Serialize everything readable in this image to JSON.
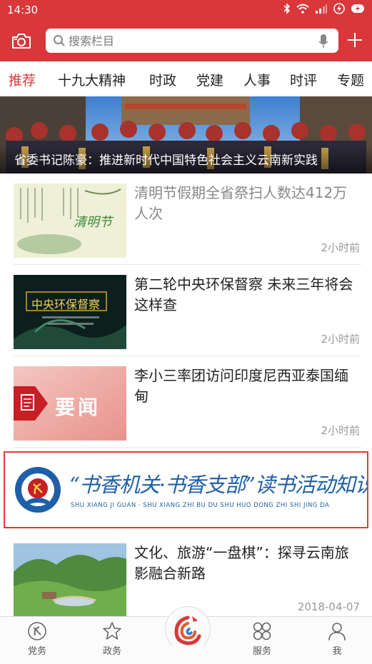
{
  "status_bar": {
    "time": "14:30"
  },
  "search": {
    "placeholder": "搜索栏目"
  },
  "tabs": [
    {
      "label": "推荐",
      "active": true
    },
    {
      "label": "十九大精神"
    },
    {
      "label": "时政"
    },
    {
      "label": "党建"
    },
    {
      "label": "人事"
    },
    {
      "label": "时评"
    },
    {
      "label": "专题"
    }
  ],
  "hero": {
    "caption": "省委书记陈豪：推进新时代中国特色社会主义云南新实践"
  },
  "news": [
    {
      "title": "清明节假期全省祭扫人数达412万人次",
      "time": "2小时前",
      "thumb_text": "清明节",
      "title_color": "#888888"
    },
    {
      "title": "第二轮中央环保督察 未来三年将会这样查",
      "time": "2小时前",
      "thumb_text": "中央环保督察"
    },
    {
      "title": "李小三率团访问印度尼西亚泰国缅甸",
      "time": "2小时前",
      "thumb_text": "要闻"
    },
    {
      "title": "文化、旅游“一盘棋”：探寻云南旅影融合新路",
      "time": "2018-04-07"
    }
  ],
  "banner": {
    "title": "“书香机关·书香支部”读书活动知识竞答",
    "subtitle": "SHU XIANG JI GUAN · SHU XIANG ZHI BU DU SHU HUO DONG ZHI SHI JING DA"
  },
  "tabbar": [
    {
      "label": "党务",
      "icon": "party-emblem-icon"
    },
    {
      "label": "政务",
      "icon": "star-icon"
    },
    {
      "label": "",
      "icon": "app-logo-icon"
    },
    {
      "label": "服务",
      "icon": "grid-icon"
    },
    {
      "label": "我",
      "icon": "user-icon"
    }
  ],
  "colors": {
    "brand": "#d9373a",
    "banner_blue": "#1f5fa8"
  }
}
